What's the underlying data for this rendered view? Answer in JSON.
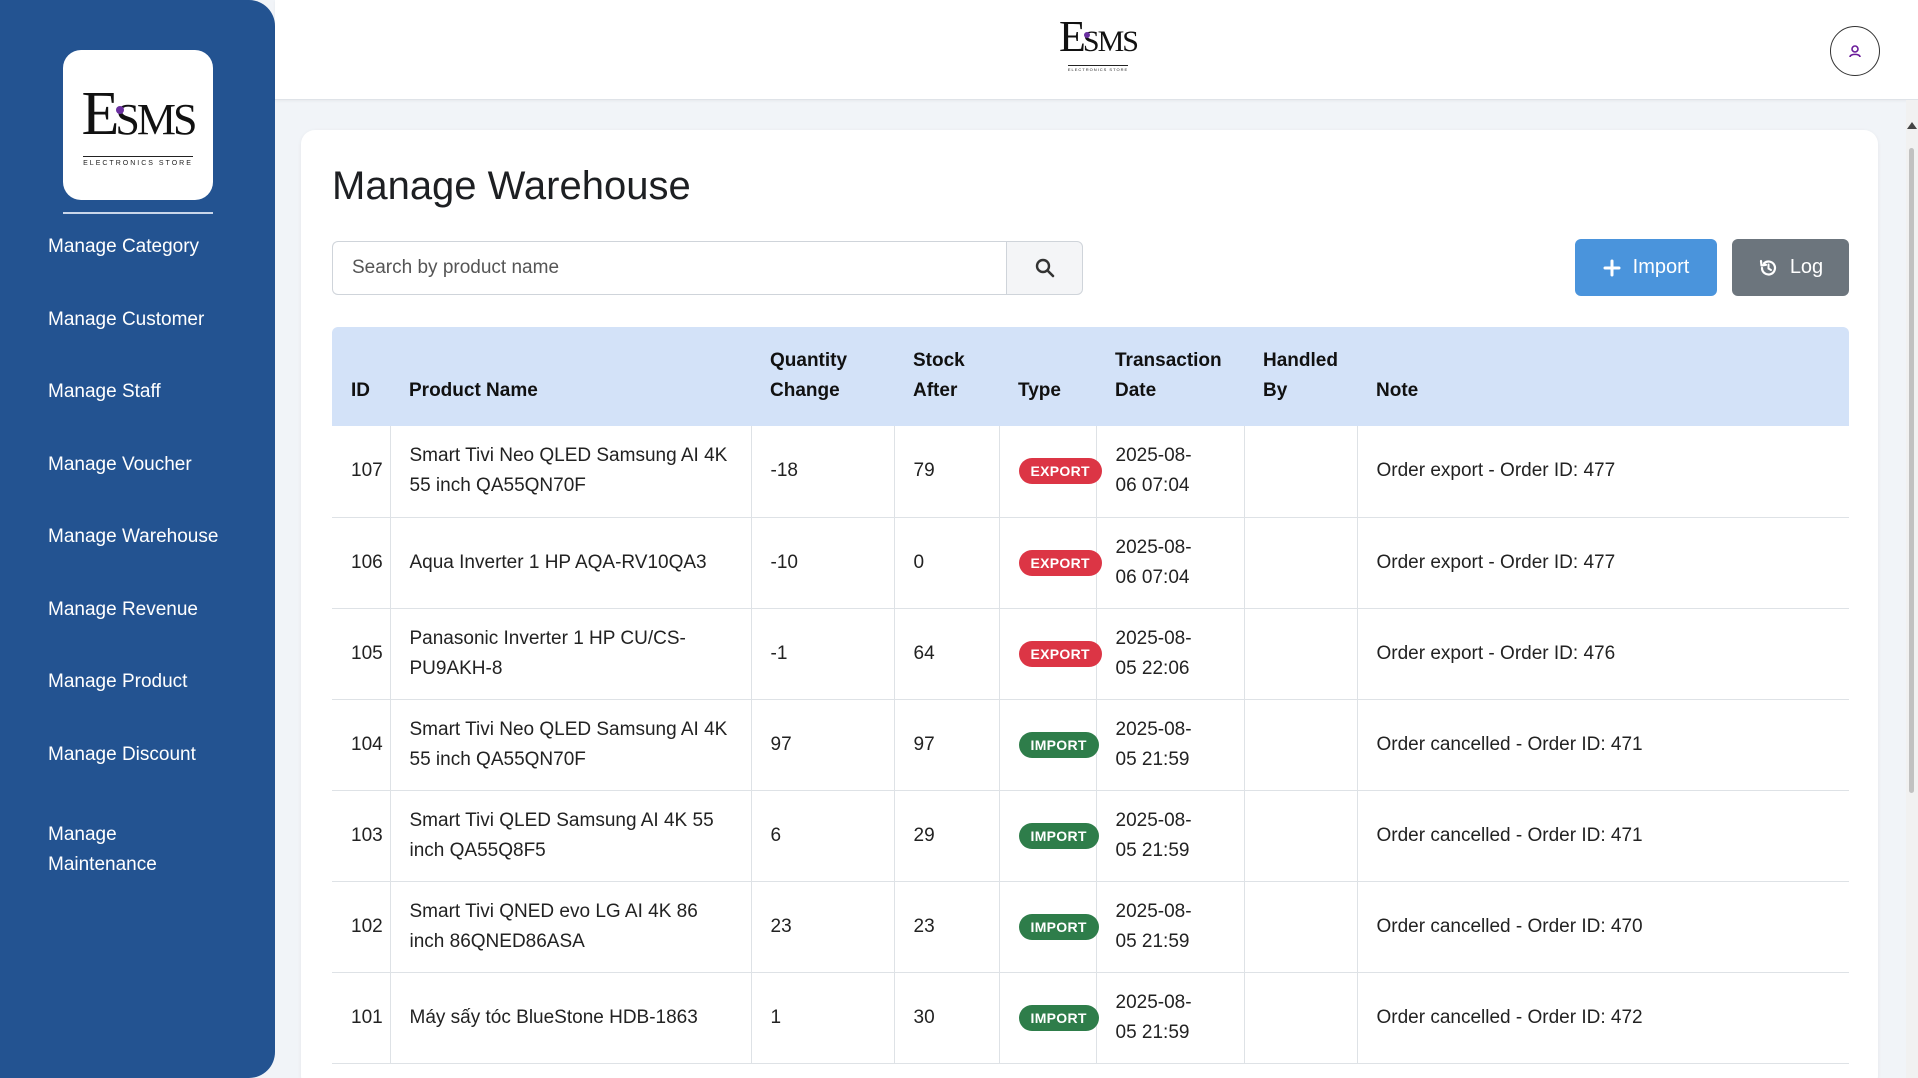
{
  "brand": {
    "logo_main": "ESMS",
    "logo_sub": "ELECTRONICS STORE"
  },
  "sidebar": {
    "items": [
      {
        "label": "Manage Category"
      },
      {
        "label": "Manage Customer"
      },
      {
        "label": "Manage Staff"
      },
      {
        "label": "Manage Voucher"
      },
      {
        "label": "Manage Warehouse"
      },
      {
        "label": "Manage Revenue"
      },
      {
        "label": "Manage Product"
      },
      {
        "label": "Manage Discount"
      },
      {
        "label": "Manage Maintenance"
      }
    ]
  },
  "header": {
    "user_icon": "user-icon"
  },
  "main": {
    "title": "Manage Warehouse",
    "search": {
      "placeholder": "Search by product name",
      "value": "",
      "icon": "search-icon"
    },
    "import_label": "Import",
    "log_label": "Log"
  },
  "table": {
    "columns": [
      "ID",
      "Product Name",
      "Quantity Change",
      "Stock After",
      "Type",
      "Transaction Date",
      "Handled By",
      "Note"
    ],
    "rows": [
      {
        "id": "107",
        "product": "Smart Tivi Neo QLED Samsung AI 4K 55 inch QA55QN70F",
        "qty": "-18",
        "stock": "79",
        "type": "EXPORT",
        "date": "2025-08-06 07:04",
        "handled": "",
        "note": "Order export - Order ID: 477"
      },
      {
        "id": "106",
        "product": "Aqua Inverter 1 HP AQA-RV10QA3",
        "qty": "-10",
        "stock": "0",
        "type": "EXPORT",
        "date": "2025-08-06 07:04",
        "handled": "",
        "note": "Order export - Order ID: 477"
      },
      {
        "id": "105",
        "product": "Panasonic Inverter 1 HP CU/CS-PU9AKH-8",
        "qty": "-1",
        "stock": "64",
        "type": "EXPORT",
        "date": "2025-08-05 22:06",
        "handled": "",
        "note": "Order export - Order ID: 476"
      },
      {
        "id": "104",
        "product": "Smart Tivi Neo QLED Samsung AI 4K 55 inch QA55QN70F",
        "qty": "97",
        "stock": "97",
        "type": "IMPORT",
        "date": "2025-08-05 21:59",
        "handled": "",
        "note": "Order cancelled - Order ID: 471"
      },
      {
        "id": "103",
        "product": "Smart Tivi QLED Samsung AI 4K 55 inch QA55Q8F5",
        "qty": "6",
        "stock": "29",
        "type": "IMPORT",
        "date": "2025-08-05 21:59",
        "handled": "",
        "note": "Order cancelled - Order ID: 471"
      },
      {
        "id": "102",
        "product": "Smart Tivi QNED evo LG AI 4K 86 inch 86QNED86ASA",
        "qty": "23",
        "stock": "23",
        "type": "IMPORT",
        "date": "2025-08-05 21:59",
        "handled": "",
        "note": "Order cancelled - Order ID: 470"
      },
      {
        "id": "101",
        "product": "Máy sấy tóc BlueStone HDB-1863",
        "qty": "1",
        "stock": "30",
        "type": "IMPORT",
        "date": "2025-08-05 21:59",
        "handled": "",
        "note": "Order cancelled - Order ID: 472"
      }
    ]
  },
  "colors": {
    "sidebar_bg": "#235391",
    "primary": "#4a94dc",
    "secondary": "#6c757d",
    "export_badge": "#dc3545",
    "import_badge": "#2e7d4a",
    "table_header": "#d3e2f8"
  }
}
